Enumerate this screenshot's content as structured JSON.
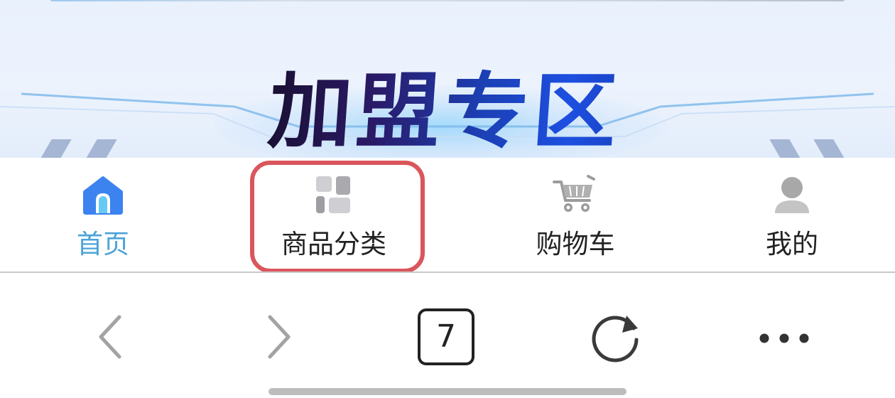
{
  "banner": {
    "title": "加盟专区"
  },
  "tabbar": {
    "items": [
      {
        "label": "首页",
        "icon": "home-icon",
        "active": true
      },
      {
        "label": "商品分类",
        "icon": "category-grid-icon",
        "active": false,
        "highlighted": true
      },
      {
        "label": "购物车",
        "icon": "shopping-cart-icon",
        "active": false
      },
      {
        "label": "我的",
        "icon": "user-icon",
        "active": false
      }
    ],
    "active_color": "#4ba3d8",
    "highlight_color": "#d9565c"
  },
  "browser_toolbar": {
    "tab_count": "7",
    "buttons": [
      "back-icon",
      "forward-icon",
      "tabs-icon",
      "reload-icon",
      "more-icon"
    ]
  }
}
